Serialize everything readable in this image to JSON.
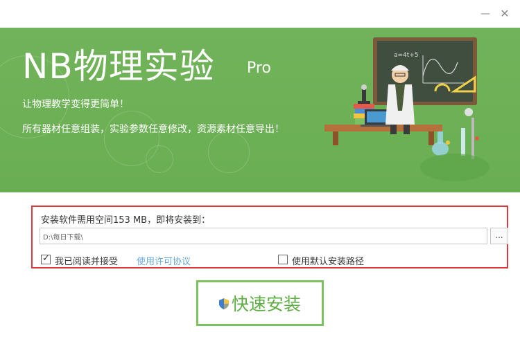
{
  "window": {
    "minimize_label": "—",
    "close_label": "✕"
  },
  "banner": {
    "title": "NB物理实验",
    "edition": "Pro",
    "slogan_1": "让物理教学变得更简单！",
    "slogan_2": "所有器材任意组装，实验参数任意修改，资源素材任意导出！",
    "board_text": "a=4t+5"
  },
  "install": {
    "space_text": "安装软件需用空间153 MB，即将安装到：",
    "path_value": "D:\\每日下载\\",
    "browse_label": "...",
    "agree_checked": true,
    "agree_label": "我已阅读并接受",
    "license_link": "使用许可协议",
    "default_path_checked": false,
    "default_path_label": "使用默认安装路径",
    "button_label": "快速安装"
  },
  "colors": {
    "banner_green": "#6cb155",
    "highlight_red": "#e0393c",
    "button_border": "#7cc15f",
    "link_blue": "#6aa8d8"
  }
}
